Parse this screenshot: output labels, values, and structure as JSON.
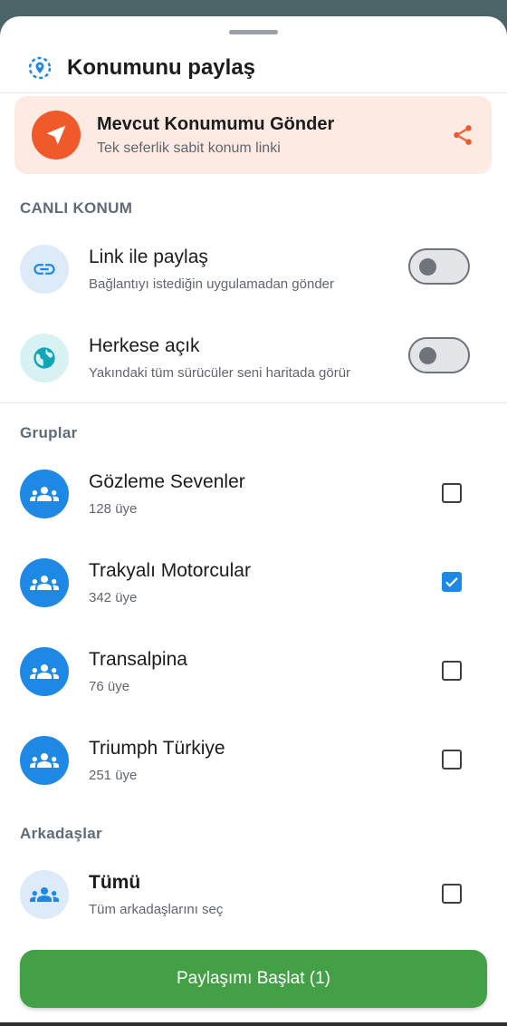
{
  "header": {
    "title": "Konumunu paylaş",
    "icon": "location-target-icon"
  },
  "send_card": {
    "title": "Mevcut Konumumu Gönder",
    "subtitle": "Tek seferlik sabit konum linki",
    "icon": "navigation-arrow-icon",
    "action_icon": "share-icon"
  },
  "live_section": {
    "label": "CANLI KONUM",
    "items": [
      {
        "title": "Link ile paylaş",
        "subtitle": "Bağlantıyı istediğin uygulamadan gönder",
        "icon": "link-icon",
        "enabled": false
      },
      {
        "title": "Herkese açık",
        "subtitle": "Yakındaki tüm sürücüler seni haritada görür",
        "icon": "globe-icon",
        "enabled": false
      }
    ]
  },
  "groups_section": {
    "label": "Gruplar",
    "items": [
      {
        "name": "Gözleme Sevenler",
        "members": "128 üye",
        "checked": false
      },
      {
        "name": "Trakyalı Motorcular",
        "members": "342 üye",
        "checked": true
      },
      {
        "name": "Transalpina",
        "members": "76 üye",
        "checked": false
      },
      {
        "name": "Triumph Türkiye",
        "members": "251 üye",
        "checked": false
      }
    ]
  },
  "friends_section": {
    "label": "Arkadaşlar",
    "all": {
      "title": "Tümü",
      "subtitle": "Tüm arkadaşlarını seç",
      "checked": false
    }
  },
  "start_button": {
    "label": "Paylaşımı Başlat (1)"
  },
  "colors": {
    "accent_orange": "#f0592a",
    "accent_blue": "#1e88e5",
    "primary_green": "#43a047"
  }
}
